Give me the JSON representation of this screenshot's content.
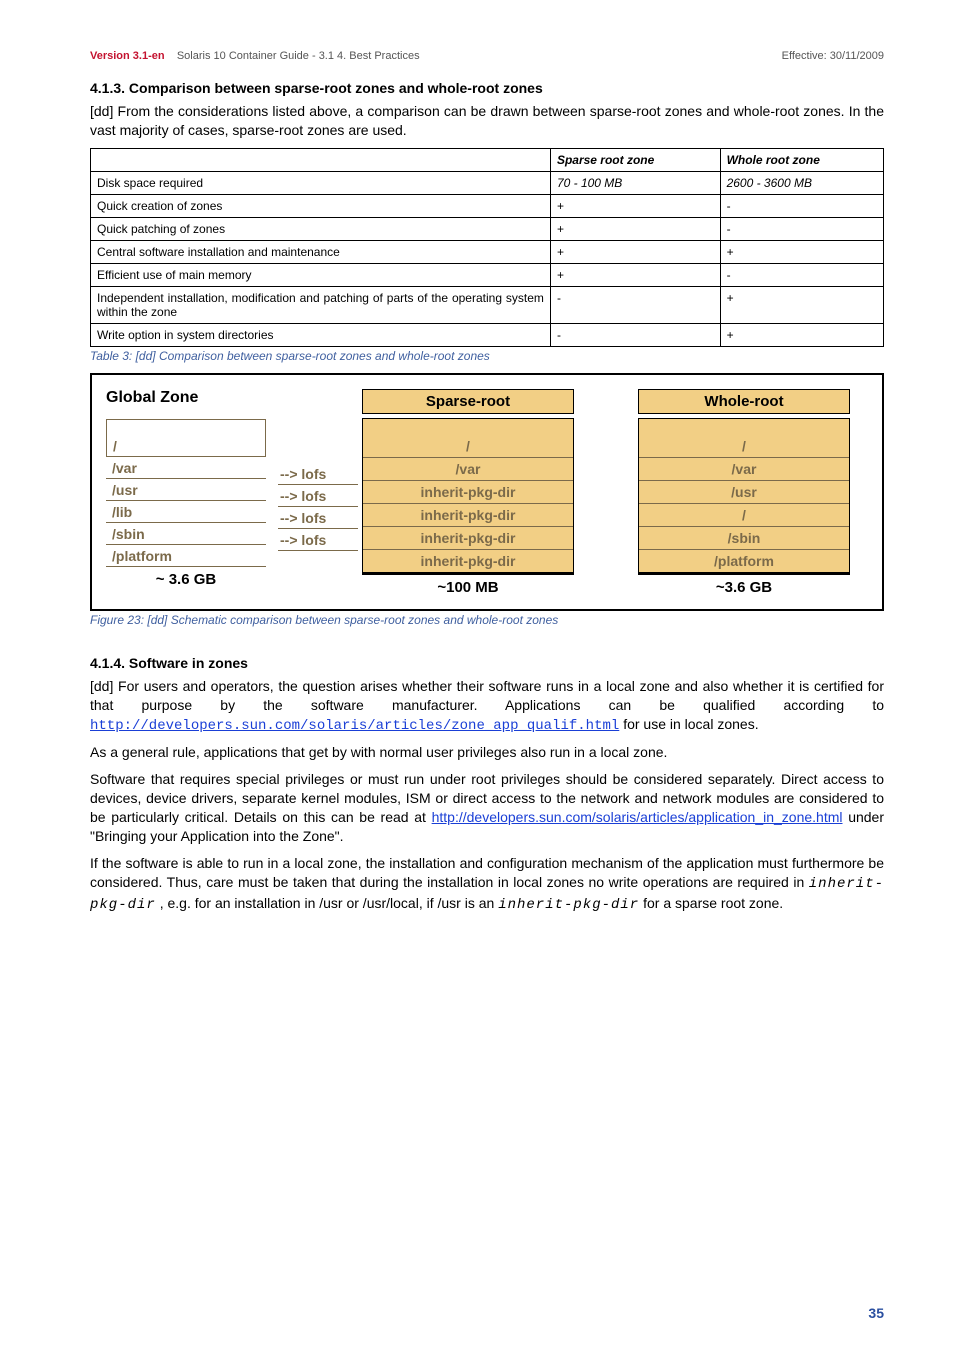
{
  "header": {
    "version": "Version 3.1-en",
    "title": "Solaris 10 Container Guide - 3.1   4. Best Practices",
    "effective": "Effective: 30/11/2009"
  },
  "sec413": {
    "heading": "4.1.3. Comparison between sparse-root zones and whole-root zones",
    "intro": "[dd] From the considerations listed above, a comparison can be drawn between sparse-root zones and whole-root zones. In the vast majority of cases, sparse-root zones are used."
  },
  "table": {
    "h1": "",
    "h2": "Sparse root zone",
    "h3": "Whole root zone",
    "rows": [
      {
        "a": "Disk space required",
        "s": "70 - 100 MB",
        "w": "2600 - 3600 MB"
      },
      {
        "a": "Quick creation of zones",
        "s": "+",
        "w": "-"
      },
      {
        "a": "Quick patching of zones",
        "s": "+",
        "w": "-"
      },
      {
        "a": "Central software installation and maintenance",
        "s": "+",
        "w": "+"
      },
      {
        "a": "Efficient use of main memory",
        "s": "+",
        "w": "-"
      },
      {
        "a": "Independent installation, modification and patching of parts of the operating system within the zone",
        "s": "-",
        "w": "+"
      },
      {
        "a": "Write option in system directories",
        "s": "-",
        "w": "+"
      }
    ],
    "caption": "Table 3: [dd] Comparison between sparse-root zones and whole-root zones"
  },
  "chart_data": {
    "type": "table",
    "global_zone": {
      "label": "Global Zone",
      "rows": [
        "/",
        "/var",
        "/usr",
        "/lib",
        "/sbin",
        "/platform"
      ],
      "total": "~ 3.6 GB"
    },
    "arrows": [
      "--> lofs",
      "--> lofs",
      "--> lofs",
      "--> lofs"
    ],
    "sparse": {
      "label": "Sparse-root",
      "rows": [
        "/",
        "/var",
        "inherit-pkg-dir",
        "inherit-pkg-dir",
        "inherit-pkg-dir",
        "inherit-pkg-dir"
      ],
      "total": "~100 MB"
    },
    "whole": {
      "label": "Whole-root",
      "rows": [
        "/",
        "/var",
        "/usr",
        "/",
        "/sbin",
        "/platform"
      ],
      "total": "~3.6 GB"
    },
    "caption": "Figure 23: [dd] Schematic comparison between sparse-root zones and whole-root zones"
  },
  "sec414": {
    "heading": "4.1.4. Software in zones",
    "p1a": "[dd] For users and operators, the question arises whether their software runs in a local zone and also whether it is certified for that purpose by the software manufacturer. Applications can be qualified according to ",
    "p1link": "http://developers.sun.com/solaris/articles/zone_app_qualif.html",
    "p1b": " for use in local zones.",
    "p2": "As a general rule, applications that get by with normal user privileges also run in a local zone.",
    "p3a": "Software that requires special privileges or must run under root privileges should be considered separately. Direct access to devices, device drivers, separate kernel modules, ISM or direct access to the network and network modules are considered to be particularly critical. Details on this can be read at ",
    "p3link": "http://developers.sun.com/solaris/articles/application_in_zone.html",
    "p3b": " under \"Bringing your Application into the Zone\".",
    "p4a": "If the software is able to run in a local zone, the installation and configuration mechanism of the application must furthermore be considered. Thus, care must be taken that during the installation in local zones no write operations are required in ",
    "p4code1": "inherit-pkg-dir",
    "p4b": ", e.g. for an installation in /usr or /usr/local, if /usr is an ",
    "p4code2": "inherit-pkg-dir",
    "p4c": " for a sparse root zone."
  },
  "pagenum": "35"
}
